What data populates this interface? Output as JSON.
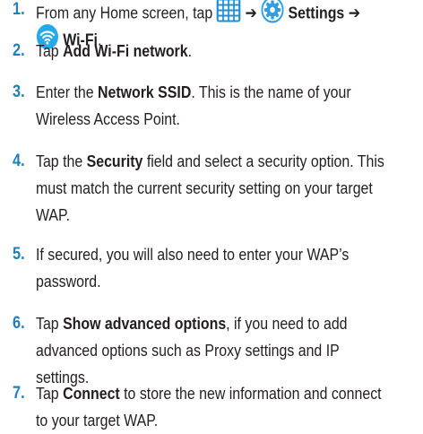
{
  "steps": [
    {
      "number": "1.",
      "lines": [
        [
          {
            "t": "text",
            "v": "From any Home screen, tap "
          },
          {
            "t": "icon",
            "name": "apps-grid-icon"
          },
          {
            "t": "text",
            "v": " ➔ "
          },
          {
            "t": "icon",
            "name": "settings-gear-icon"
          },
          {
            "t": "bold",
            "v": " Settings ➔"
          }
        ],
        [
          {
            "t": "icon",
            "name": "wifi-icon"
          },
          {
            "t": "bold",
            "v": " Wi-Fi"
          },
          {
            "t": "text",
            "v": "."
          }
        ]
      ]
    },
    {
      "number": "2.",
      "lines": [
        [
          {
            "t": "text",
            "v": "Tap "
          },
          {
            "t": "bold",
            "v": "Add Wi-Fi network"
          },
          {
            "t": "text",
            "v": "."
          }
        ]
      ]
    },
    {
      "number": "3.",
      "lines": [
        [
          {
            "t": "text",
            "v": "Enter the "
          },
          {
            "t": "bold",
            "v": "Network SSID"
          },
          {
            "t": "text",
            "v": ". This is the name of your"
          }
        ],
        [
          {
            "t": "text",
            "v": "Wireless Access Point."
          }
        ]
      ]
    },
    {
      "number": "4.",
      "lines": [
        [
          {
            "t": "text",
            "v": "Tap the "
          },
          {
            "t": "bold",
            "v": "Security"
          },
          {
            "t": "text",
            "v": " field and select a security option. This"
          }
        ],
        [
          {
            "t": "text",
            "v": "must match the current security setting on your target"
          }
        ],
        [
          {
            "t": "text",
            "v": "WAP."
          }
        ]
      ]
    },
    {
      "number": "5.",
      "lines": [
        [
          {
            "t": "text",
            "v": "If secured, you will also need to enter your WAP’s"
          }
        ],
        [
          {
            "t": "text",
            "v": "password."
          }
        ]
      ]
    },
    {
      "number": "6.",
      "lines": [
        [
          {
            "t": "text",
            "v": "Tap "
          },
          {
            "t": "bold",
            "v": "Show advanced options"
          },
          {
            "t": "text",
            "v": ", if you need to add"
          }
        ],
        [
          {
            "t": "text",
            "v": "advanced options such as Proxy settings and IP"
          }
        ],
        [
          {
            "t": "text",
            "v": "settings."
          }
        ]
      ]
    },
    {
      "number": "7.",
      "lines": [
        [
          {
            "t": "text",
            "v": "Tap "
          },
          {
            "t": "bold",
            "v": "Connect"
          },
          {
            "t": "text",
            "v": " to store the new information and connect"
          }
        ],
        [
          {
            "t": "text",
            "v": "to your target WAP."
          }
        ]
      ]
    }
  ],
  "colors": {
    "number": "#1f7fb8",
    "text": "#231f20",
    "grid_icon": "#1e8fd0",
    "settings_icon": "#2f9fe0",
    "wifi_icon": "#25a9e8"
  }
}
